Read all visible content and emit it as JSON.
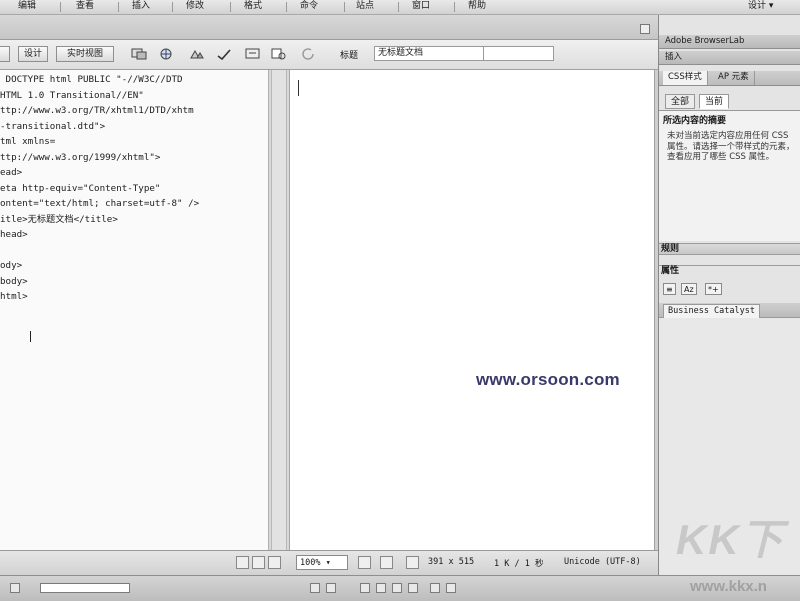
{
  "menu": {
    "items": [
      "编辑",
      "查看",
      "插入",
      "修改",
      "格式",
      "命令",
      "站点",
      "窗口",
      "帮助"
    ],
    "keys": [
      "E",
      "V",
      "I",
      "M",
      "O",
      "C",
      "S",
      "W",
      "H"
    ],
    "workspace": "设计"
  },
  "toolbar": {
    "code_label": "",
    "design_label": "设计",
    "live_view_label": "实时视图",
    "title_label": "标题",
    "title_value": "无标题文档"
  },
  "code": {
    "lines": [
      " DOCTYPE html PUBLIC \"-//W3C//DTD",
      "HTML 1.0 Transitional//EN\"",
      "ttp://www.w3.org/TR/xhtml1/DTD/xhtm",
      "-transitional.dtd\">",
      "tml xmlns=",
      "ttp://www.w3.org/1999/xhtml\">",
      "ead>",
      "eta http-equiv=\"Content-Type\"",
      "ontent=\"text/html; charset=utf-8\" />",
      "itle>无标题文档</title>",
      "head>",
      "",
      "ody>",
      "body>",
      "html>"
    ]
  },
  "design": {
    "watermark": "www.orsoon.com"
  },
  "statusbar": {
    "zoom": "100%",
    "size": "391 x 515",
    "weight": "1 K / 1 秒",
    "encoding": "Unicode (UTF-8)"
  },
  "right_panel": {
    "browserlab_title": "Adobe BrowserLab",
    "insert_title": "插入",
    "css_tab": "CSS样式",
    "ap_tab": "AP",
    "elements_tab": "元素",
    "all_btn": "全部",
    "current_btn": "当前",
    "summary_title": "所选内容的摘要",
    "summary_text": "未对当前选定内容应用任何 CSS 属性。请选择一个带样式的元素，查看应用了哪些 CSS 属性。",
    "rules_label": "规则",
    "props_label": "属性",
    "business_catalyst": "Business Catalyst"
  },
  "branding": {
    "kk": "KK下",
    "kk_url": "www.kkx.n"
  }
}
